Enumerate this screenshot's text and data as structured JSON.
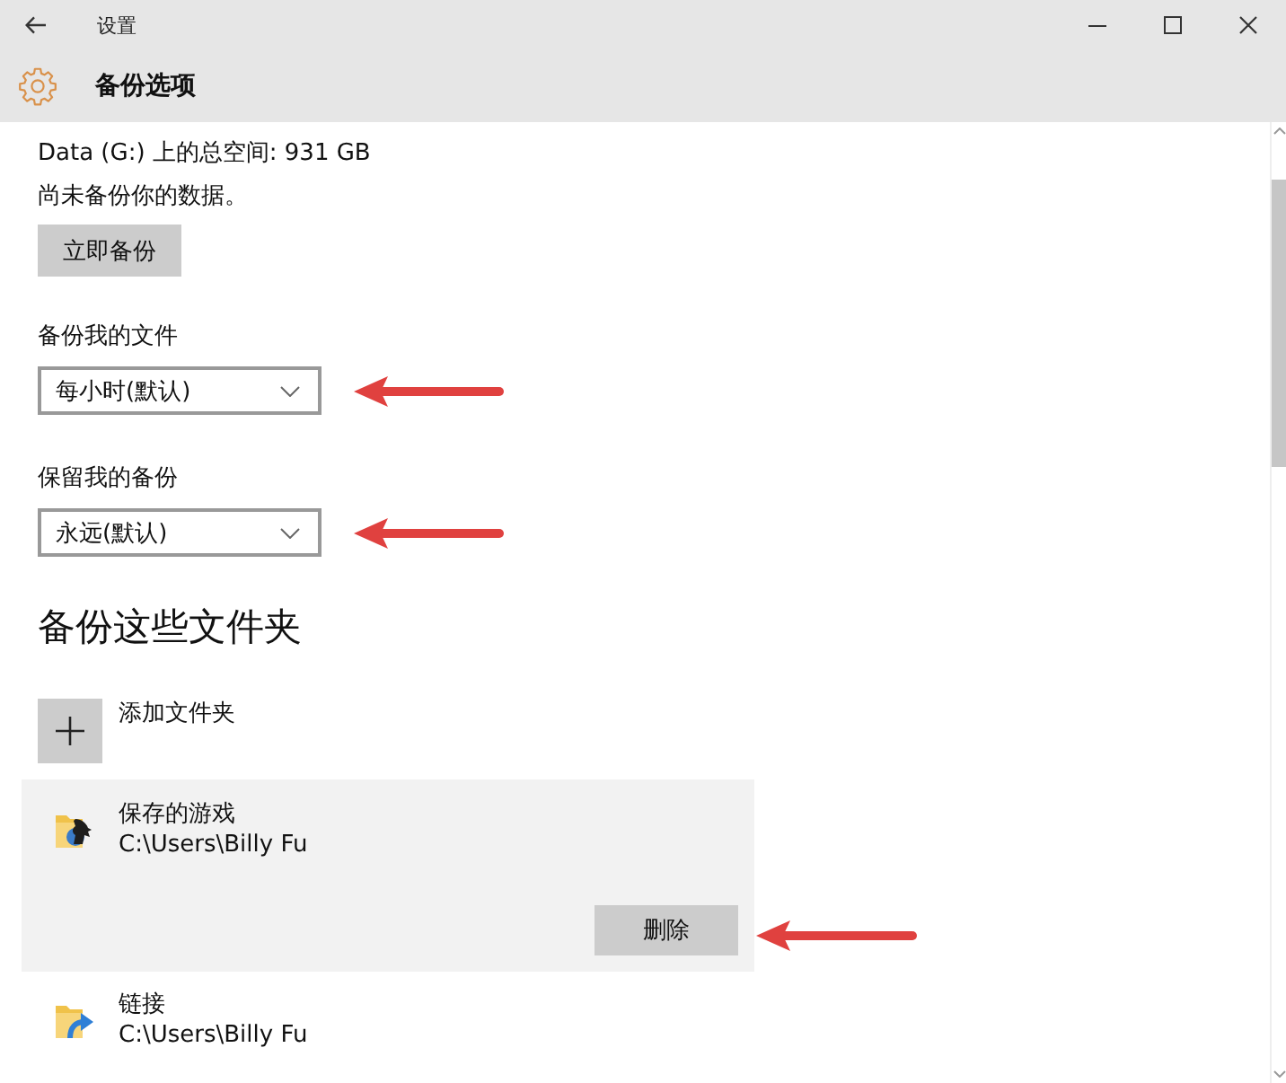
{
  "window": {
    "title": "设置"
  },
  "header": {
    "title": "备份选项"
  },
  "overview": {
    "drive_space": "Data (G:) 上的总空间: 931 GB",
    "status": "尚未备份你的数据。",
    "backup_now_button": "立即备份"
  },
  "settings": [
    {
      "label": "备份我的文件",
      "value": "每小时(默认)",
      "arrow": true
    },
    {
      "label": "保留我的备份",
      "value": "永远(默认)",
      "arrow": true
    }
  ],
  "folders_section": {
    "heading": "备份这些文件夹",
    "add_button": "添加文件夹",
    "folders": [
      {
        "kind": "games",
        "name": "保存的游戏",
        "path": "C:\\Users\\Billy Fu",
        "selected": true,
        "remove_button": "删除",
        "arrow": true
      },
      {
        "kind": "links",
        "name": "链接",
        "path": "C:\\Users\\Billy Fu",
        "selected": false,
        "arrow": false
      }
    ]
  }
}
